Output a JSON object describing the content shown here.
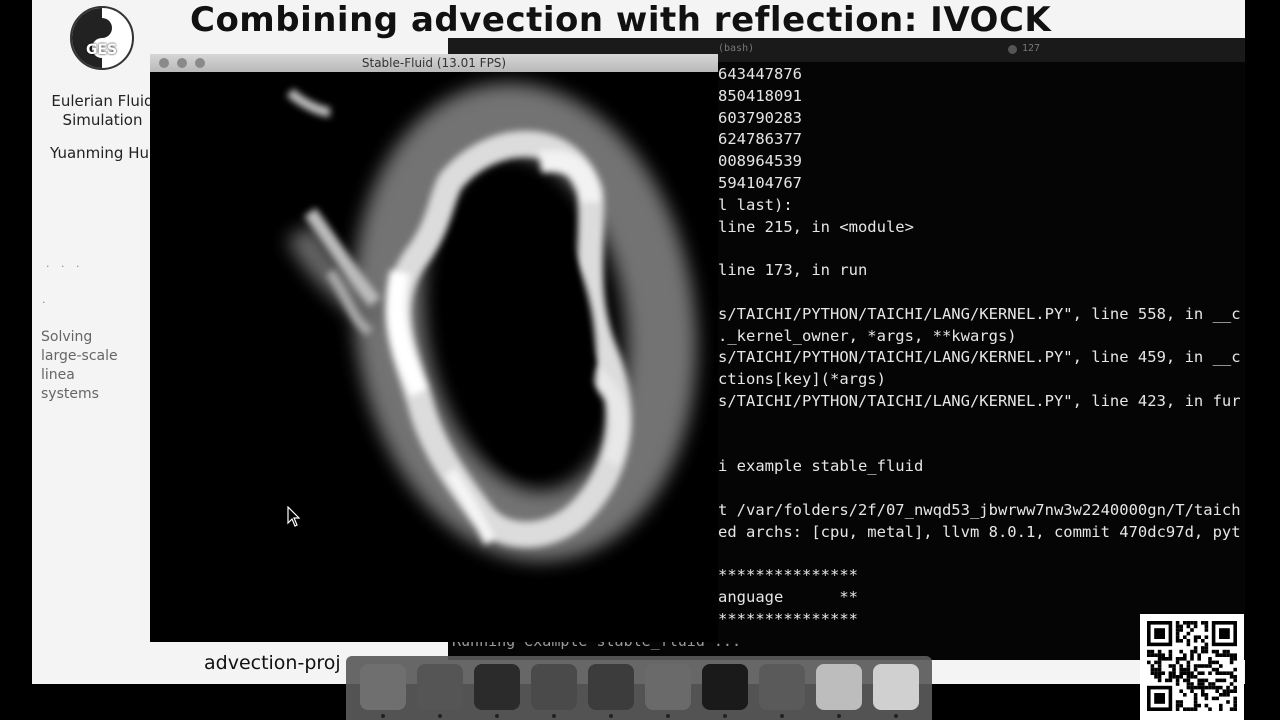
{
  "slide": {
    "title": "Combining advection with reflection: IVOCK",
    "logo_text": "GES",
    "sidebar": {
      "course_title": "Eulerian Fluid\nSimulation",
      "author": "Yuanming Hu",
      "section_dots": "· · ·",
      "section_dot2": "·",
      "section": "Solving\nlarge-scale linea\nsystems"
    },
    "bottom_caption": "advection-proj"
  },
  "fluid_window": {
    "title": "Stable-Fluid (13.01 FPS)"
  },
  "terminal": {
    "title_fragment": "(bash)",
    "title_fragment2": "127",
    "lines": [
      "643447876",
      "850418091",
      "603790283",
      "624786377",
      "008964539",
      "594104767",
      "l last):",
      "line 215, in <module>",
      "",
      "line 173, in run",
      "",
      "s/TAICHI/PYTHON/TAICHI/LANG/KERNEL.PY\", line 558, in __c",
      "._kernel_owner, *args, **kwargs)",
      "s/TAICHI/PYTHON/TAICHI/LANG/KERNEL.PY\", line 459, in __c",
      "ctions[key](*args)",
      "s/TAICHI/PYTHON/TAICHI/LANG/KERNEL.PY\", line 423, in fur",
      "",
      "",
      "i example stable_fluid",
      "",
      "t /var/folders/2f/07_nwqd53_jbwrww7nw3w2240000gn/T/taich",
      "ed archs: [cpu, metal], llvm 8.0.1, commit 470dc97d, pyt",
      "",
      "***************",
      "anguage      **",
      "***************"
    ],
    "running_line": "Running example stable_fluid ..."
  },
  "dock": {
    "items": [
      {
        "name": "finder-icon",
        "color": "#6f6f6f"
      },
      {
        "name": "chrome-icon",
        "color": "#555555"
      },
      {
        "name": "terminal-icon",
        "color": "#2b2b2b"
      },
      {
        "name": "matlab-icon",
        "color": "#4a4a4a"
      },
      {
        "name": "vscode-icon",
        "color": "#3c3c3c"
      },
      {
        "name": "keynote-icon",
        "color": "#6a6a6a"
      },
      {
        "name": "obs-icon",
        "color": "#1a1a1a"
      },
      {
        "name": "inkscape-icon",
        "color": "#5a5a5a"
      },
      {
        "name": "documents-folder-icon",
        "color": "#bdbdbd"
      },
      {
        "name": "trash-icon",
        "color": "#d0d0d0"
      }
    ]
  }
}
